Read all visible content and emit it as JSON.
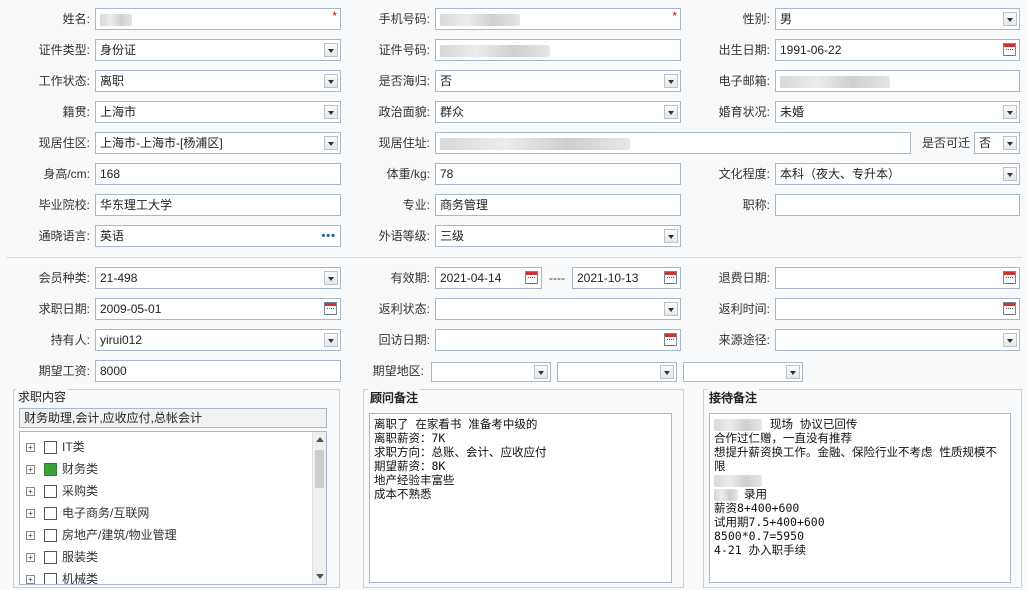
{
  "basic": {
    "name_label": "姓名:",
    "phone_label": "手机号码:",
    "gender_label": "性别:",
    "gender_value": "男",
    "id_type_label": "证件类型:",
    "id_type_value": "身份证",
    "id_no_label": "证件号码:",
    "birth_label": "出生日期:",
    "birth_value": "1991-06-22",
    "work_status_label": "工作状态:",
    "work_status_value": "离职",
    "overseas_label": "是否海归:",
    "overseas_value": "否",
    "email_label": "电子邮箱:",
    "native_label": "籍贯:",
    "native_value": "上海市",
    "political_label": "政治面貌:",
    "political_value": "群众",
    "marital_label": "婚育状况:",
    "marital_value": "未婚",
    "district_label": "现居住区:",
    "district_value": "上海市-上海市-[杨浦区]",
    "address_label": "现居住址:",
    "migrate_label": "是否可迁",
    "migrate_value": "否",
    "height_label": "身高/cm:",
    "height_value": "168",
    "weight_label": "体重/kg:",
    "weight_value": "78",
    "education_label": "文化程度:",
    "education_value": "本科（夜大、专升本）",
    "school_label": "毕业院校:",
    "school_value": "华东理工大学",
    "major_label": "专业:",
    "major_value": "商务管理",
    "title_label": "职称:",
    "title_value": "",
    "language_label": "通晓语言:",
    "language_value": "英语",
    "lang_level_label": "外语等级:",
    "lang_level_value": "三级"
  },
  "member": {
    "type_label": "会员种类:",
    "type_value": "21-498",
    "valid_label": "有效期:",
    "valid_from": "2021-04-14",
    "valid_sep": "----",
    "valid_to": "2021-10-13",
    "refund_label": "退费日期:",
    "apply_label": "求职日期:",
    "apply_value": "2009-05-01",
    "rebate_status_label": "返利状态:",
    "rebate_time_label": "返利时间:",
    "holder_label": "持有人:",
    "holder_value": "yirui012",
    "visit_label": "回访日期:",
    "source_label": "来源途径:",
    "salary_label": "期望工资:",
    "salary_value": "8000",
    "region_label": "期望地区:"
  },
  "job_panel": {
    "title": "求职内容",
    "summary": "财务助理,会计,应收应付,总帐会计",
    "items": [
      {
        "label": "IT类",
        "checked": false
      },
      {
        "label": "财务类",
        "checked": true
      },
      {
        "label": "采购类",
        "checked": false
      },
      {
        "label": "电子商务/互联网",
        "checked": false
      },
      {
        "label": "房地产/建筑/物业管理",
        "checked": false
      },
      {
        "label": "服装类",
        "checked": false
      },
      {
        "label": "机械类",
        "checked": false
      }
    ]
  },
  "advisor_panel": {
    "title": "顾问备注",
    "text": "离职了 在家看书 准备考中级的\n离职薪资：7K\n求职方向：总账、会计、应收应付\n期望薪资：8K\n地产经验丰富些\n成本不熟悉"
  },
  "reception_panel": {
    "title": "接待备注",
    "line1": "现场 协议已回传",
    "text": "合作过仁赠，一直没有推荐\n想提升薪资换工作。金融、保险行业不考虑 性质规模不限",
    "hire": "录用",
    "text2": "薪资8+400+600\n试用期7.5+400+600\n8500*0.7=5950\n4-21 办入职手续"
  }
}
